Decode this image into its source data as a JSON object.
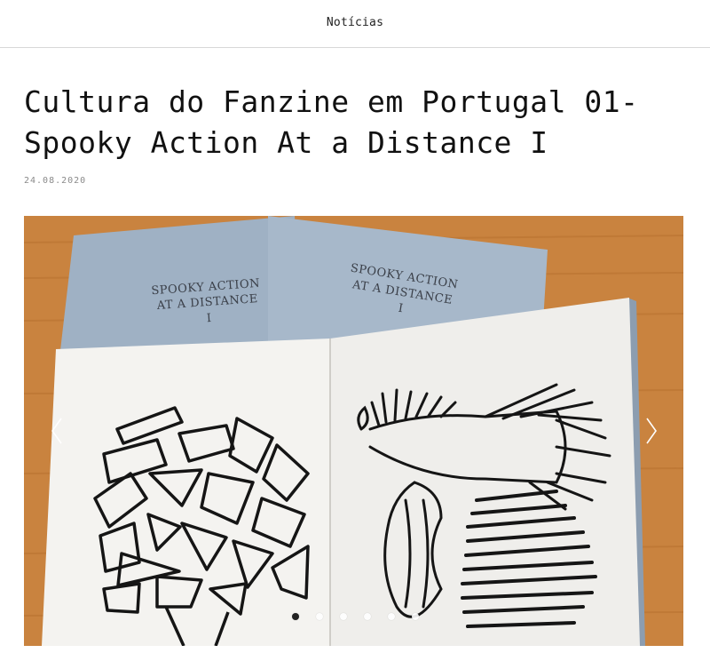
{
  "nav": {
    "link_label": "Notícias"
  },
  "article": {
    "title": "Cultura do Fanzine em Portugal 01- Spooky Action At a Distance I",
    "date": "24.08.2020"
  },
  "gallery": {
    "cover_text": {
      "line1": "SPOOKY ACTION",
      "line2": "AT A DISTANCE",
      "line3": "I"
    },
    "slide_count": 6,
    "active_index": 0,
    "colors": {
      "table": "#c9833f",
      "cover": "#9fb1c4",
      "page": "#f4f3f0",
      "ink": "#151515"
    }
  }
}
